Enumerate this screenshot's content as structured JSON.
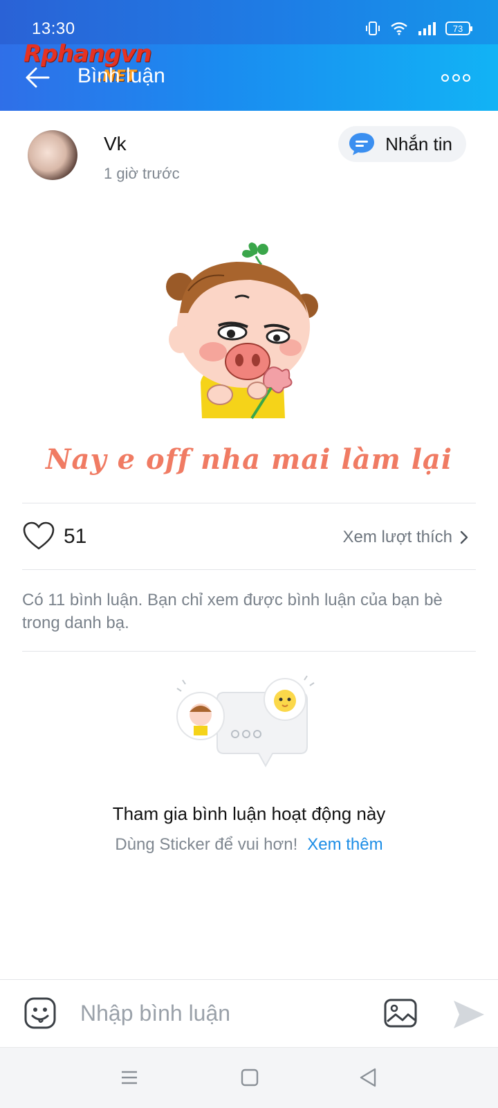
{
  "status_bar": {
    "time": "13:30",
    "battery": "73"
  },
  "header": {
    "title": "Bình luận",
    "watermark": "Rphangvn",
    "watermark_suffix": ".NET"
  },
  "post": {
    "author": "Vk",
    "time": "1 giờ trước",
    "message_button": "Nhắn tin",
    "status_text": "Nay e off nha mai làm lại"
  },
  "likes": {
    "count": "51",
    "view_label": "Xem lượt thích"
  },
  "comments": {
    "note": "Có 11 bình luận. Bạn chỉ xem được bình luận của bạn bè trong danh bạ.",
    "empty_title": "Tham gia bình luận hoạt động này",
    "empty_subtitle": "Dùng Sticker để vui hơn!",
    "empty_link": "Xem thêm"
  },
  "composer": {
    "placeholder": "Nhập bình luận"
  },
  "colors": {
    "header_start": "#2f6fe8",
    "header_end": "#12b3f5",
    "accent_link": "#1b8de6",
    "status_text": "#f07b63"
  },
  "icons": [
    "back-arrow-icon",
    "more-icon",
    "message-icon",
    "heart-icon",
    "chevron-right-icon",
    "emoji-icon",
    "image-icon",
    "send-icon",
    "nav-menu-icon",
    "nav-home-icon",
    "nav-back-icon"
  ]
}
